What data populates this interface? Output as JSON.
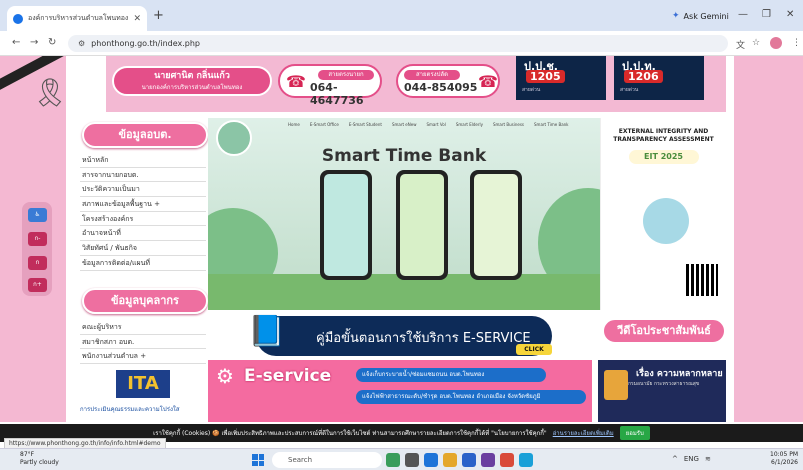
{
  "browser": {
    "tab_title": "องค์การบริหารส่วนตำบลโพนทอง อำ...",
    "gemini_label": "Ask Gemini",
    "url": "phonthong.go.th/index.php"
  },
  "header": {
    "mayor_name": "นายศานิต กลิ่นแก้ว",
    "mayor_title": "นายกองค์การบริหารส่วนตำบลโพนทอง",
    "phone1_label": "สายตรงนายก",
    "phone1": "064-4647736",
    "phone2_label": "สายตรงปลัด",
    "phone2": "044-854095",
    "hotline1_title": "ป.ป.ช.",
    "hotline1_number": "1205",
    "hotline2_title": "ป.ป.ท.",
    "hotline2_number": "1206",
    "hotline_sub": "สายด่วน"
  },
  "side_buttons": [
    "ก-",
    "ก",
    "ก+"
  ],
  "sidebar": {
    "info_heading": "ข้อมูลอบต.",
    "info_items": [
      "หน้าหลัก",
      "สารจากนายกอบต.",
      "ประวัติความเป็นมา",
      "สภาพและข้อมูลพื้นฐาน +",
      "โครงสร้างองค์กร",
      "อำนาจหน้าที่",
      "วิสัยทัศน์ / พันธกิจ",
      "ข้อมูลการติดต่อ/แผนที่"
    ],
    "staff_heading": "ข้อมูลบุคลากร",
    "staff_items": [
      "คณะผู้บริหาร",
      "สมาชิกสภา อบต.",
      "พนักงานส่วนตำบล +"
    ],
    "ita_label": "ITA",
    "ita_sub": "การประเมินคุณธรรมและความโปร่งใส"
  },
  "banner": {
    "nav": [
      "Home",
      "E-Smart Office",
      "E-Smart Student",
      "Smart eNew",
      "Smart Vol",
      "Smart Elderly",
      "Smart Business",
      "Smart Time Bank"
    ],
    "title": "Smart Time Bank"
  },
  "eit": {
    "title": "EXTERNAL INTEGRITY AND TRANSPARENCY ASSESSMENT",
    "logo": "EIT 2025"
  },
  "eservice_button": {
    "label": "คู่มือขั้นตอนการใช้บริการ E-SERVICE",
    "click": "CLICK"
  },
  "video_button": "วีดีโอประชาสัมพันธ์",
  "eservice_panel": {
    "title": "E-service",
    "row1": "แจ้งเก็บกระบายน้ำ/ซ่อมแซมถนน อบต.โพนทอง",
    "row2": "แจ้งไฟฟ้าสาธารณะดับ/ชำรุด อบต.โพนทอง อำเภอเมือง จังหวัดชัยภูมิ"
  },
  "story": {
    "title": "เรื่อง ความหลากหลาย",
    "sub": "กรมอนามัย กระทรวงสาธารณสุข"
  },
  "cookie": {
    "text": "เราใช้คุกกี้ (Cookies) 🍪 เพื่อเพิ่มประสิทธิภาพและประสบการณ์ที่ดีในการใช้เว็บไซต์ ท่านสามารถศึกษารายละเอียดการใช้คุกกี้ได้ที่ \"นโยบายการใช้คุกกี้\"",
    "link": "อ่านรายละเอียดเพิ่มเติม",
    "accept": "ยอมรับ"
  },
  "status_url": "https://www.phonthong.go.th/info/info.html#demo",
  "taskbar": {
    "temp": "87°F",
    "weather": "Partly cloudy",
    "search": "Search",
    "lang": "ENG",
    "time": "10:05 PM",
    "date": "6/1/2026"
  },
  "colors": {
    "pink": "#ee6fa0",
    "navy": "#0d2b58",
    "bg_pink": "#f4b8d2"
  }
}
